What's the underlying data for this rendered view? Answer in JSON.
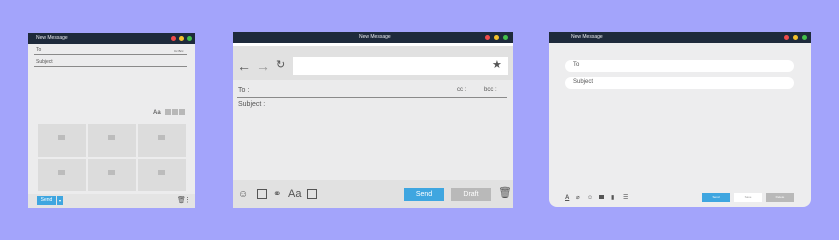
{
  "windows": [
    {
      "title": "New Message",
      "fields": {
        "to_label": "To",
        "to_extra": "Cc Bcc",
        "subject_label": "Subject"
      },
      "format_label": "Aa",
      "send_label": "Send"
    },
    {
      "title": "New Message",
      "fields": {
        "to_label": "To :",
        "cc_label": "cc :",
        "bcc_label": "bcc :",
        "subject_label": "Subject :"
      },
      "toolbar": {
        "font_label": "Aa"
      },
      "send_label": "Send",
      "draft_label": "Draft"
    },
    {
      "title": "New Message",
      "fields": {
        "to_label": "To",
        "subject_label": "Subject"
      },
      "send_label": "Send",
      "draft_label": "Save",
      "delete_label": "Delete"
    }
  ],
  "colors": {
    "background": "#a3a4fb",
    "titlebar": "#1e2a3b",
    "send": "#3fa6e0",
    "draft": "#b9b9b9"
  }
}
